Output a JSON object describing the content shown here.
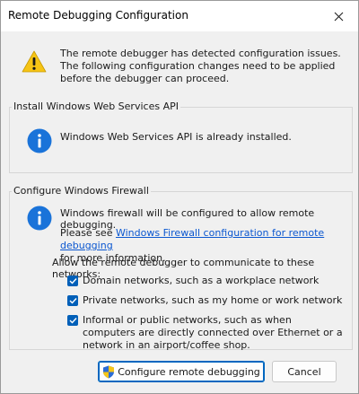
{
  "window": {
    "title": "Remote Debugging Configuration",
    "close_symbol": "✕"
  },
  "warning": {
    "icon": "warning-icon",
    "text": "The remote debugger has detected configuration issues. The following configuration changes need to be applied before the debugger can proceed."
  },
  "api_group": {
    "label": "Install Windows Web Services API",
    "icon": "info-icon",
    "text": "Windows Web Services API is already installed."
  },
  "firewall_group": {
    "label": "Configure Windows Firewall",
    "icon": "info-icon",
    "text1": "Windows firewall will be configured to allow remote debugging.",
    "please_see": "Please see ",
    "link": "Windows Firewall configuration for remote debugging",
    "more_info": "for more information.",
    "allow_text": "Allow the remote debugger to communicate to these networks:",
    "checkboxes": [
      {
        "label": "Domain networks, such as a workplace network",
        "checked": true
      },
      {
        "label": "Private networks, such as my home or work network",
        "checked": true
      },
      {
        "label": "Informal or public networks, such as when computers are directly connected over Ethernet or a network in an airport/coffee shop.",
        "checked": true
      }
    ]
  },
  "buttons": {
    "configure": "Configure remote debugging",
    "cancel": "Cancel"
  },
  "colors": {
    "accent": "#005fb8",
    "link": "#0b57d0",
    "info_blue": "#1a73d9",
    "warning_yellow": "#f6c415"
  }
}
